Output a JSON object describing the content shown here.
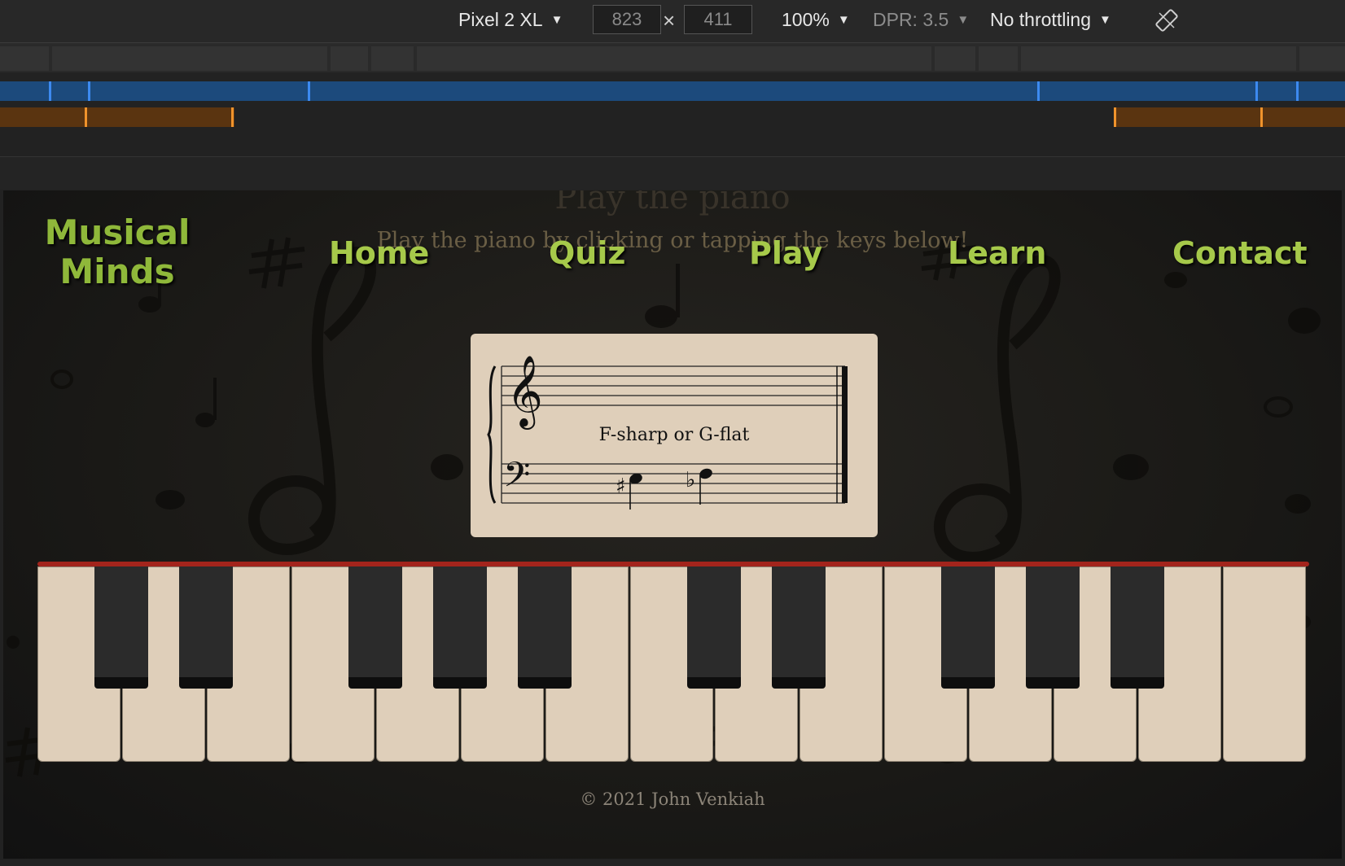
{
  "devtools": {
    "device": "Pixel 2 XL",
    "width": "823",
    "height": "411",
    "zoom": "100%",
    "dpr": "DPR: 3.5",
    "throttling": "No throttling",
    "times_symbol": "×",
    "colors": {
      "blue_bar": "#1c4a7c",
      "orange_bar": "#5a3410"
    }
  },
  "site": {
    "brand_line1": "Musical",
    "brand_line2": "Minds",
    "nav": [
      "Home",
      "Quiz",
      "Play",
      "Learn",
      "Contact"
    ],
    "hero_title": "Play the piano",
    "hero_subtitle": "Play the piano by clicking or tapping the keys below!",
    "note_name": "F-sharp or G-flat",
    "footer": "© 2021 John Venkiah",
    "keyboard": {
      "white_keys": 15,
      "black_keys": 10
    },
    "colors": {
      "brand_green": "#8fb83a",
      "nav_green": "#a6c94a",
      "key_ivory": "#dfcfba",
      "felt_red": "#a3241c"
    }
  }
}
